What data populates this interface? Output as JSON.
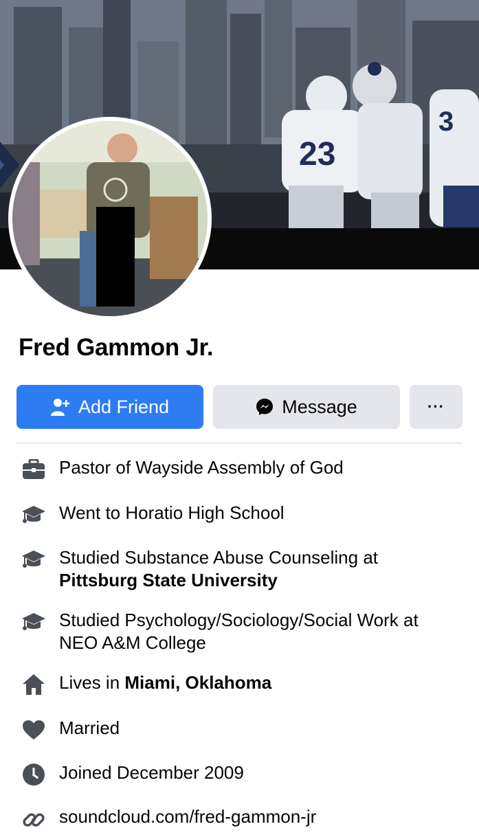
{
  "profile": {
    "name": "Fred Gammon Jr."
  },
  "actions": {
    "add_friend_label": "Add Friend",
    "message_label": "Message",
    "more_label": "···"
  },
  "about": {
    "work": "Pastor of Wayside Assembly of God",
    "school_high": "Went to Horatio High School",
    "school_1_prefix": "Studied Substance Abuse Counseling at",
    "school_1_name": "Pittsburg State University",
    "school_2": "Studied Psychology/Sociology/Social Work at NEO A&M College",
    "lives_prefix": "Lives in",
    "lives_place": "Miami, Oklahoma",
    "relationship": "Married",
    "joined": "Joined December 2009",
    "link": "soundcloud.com/fred-gammon-jr"
  },
  "colors": {
    "primary_button": "#2d7cf2",
    "secondary_button": "#e4e6eb",
    "icon_gray": "#4b4f56"
  },
  "icons": {
    "work": "briefcase-icon",
    "education": "graduation-cap-icon",
    "home": "house-icon",
    "relationship": "heart-icon",
    "joined": "clock-icon",
    "link": "link-icon",
    "add_friend": "add-person-icon",
    "message": "messenger-icon"
  }
}
